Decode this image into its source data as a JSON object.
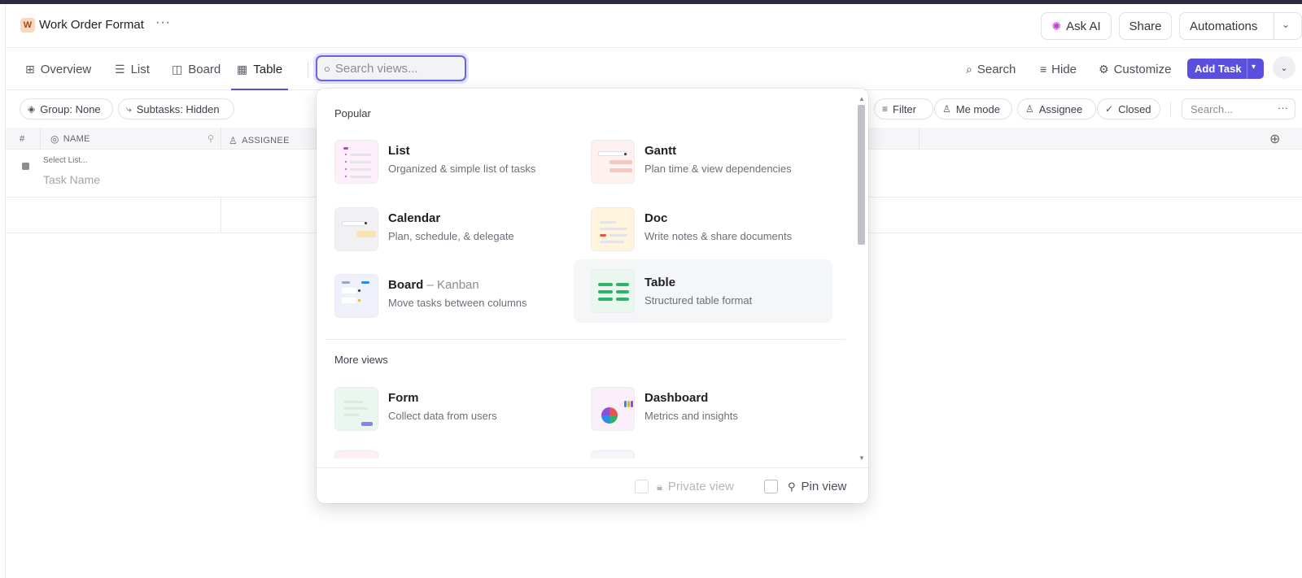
{
  "header": {
    "workspace_initial": "W",
    "page_title": "Work Order Format",
    "more": "···",
    "ask_ai": "Ask AI",
    "share": "Share",
    "automations": "Automations"
  },
  "tabs": [
    {
      "label": "Overview",
      "icon": "overview-icon"
    },
    {
      "label": "List",
      "icon": "list-icon"
    },
    {
      "label": "Board",
      "icon": "board-icon"
    },
    {
      "label": "Table",
      "icon": "table-icon",
      "active": true
    }
  ],
  "search_views": {
    "placeholder": "Search views...",
    "value": ""
  },
  "toolbar": {
    "search": "Search",
    "hide": "Hide",
    "customize": "Customize",
    "add_task": "Add Task"
  },
  "filters": {
    "group": "Group: None",
    "subtasks": "Subtasks: Hidden",
    "filter": "Filter",
    "me_mode": "Me mode",
    "assignee": "Assignee",
    "closed": "Closed",
    "search_placeholder": "Search..."
  },
  "table": {
    "columns": [
      "#",
      "NAME",
      "ASSIGNEE"
    ],
    "row": {
      "select_list": "Select List...",
      "task_name_placeholder": "Task Name"
    }
  },
  "dropdown": {
    "popular_label": "Popular",
    "popular": [
      {
        "title": "List",
        "subtitle": "",
        "desc": "Organized & simple list of tasks"
      },
      {
        "title": "Gantt",
        "subtitle": "",
        "desc": "Plan time & view dependencies"
      },
      {
        "title": "Calendar",
        "subtitle": "",
        "desc": "Plan, schedule, & delegate"
      },
      {
        "title": "Doc",
        "subtitle": "",
        "desc": "Write notes & share documents"
      },
      {
        "title": "Board",
        "subtitle": " – Kanban",
        "desc": "Move tasks between columns"
      },
      {
        "title": "Table",
        "subtitle": "",
        "desc": "Structured table format"
      }
    ],
    "more_label": "More views",
    "more": [
      {
        "title": "Form",
        "desc": "Collect data from users"
      },
      {
        "title": "Dashboard",
        "desc": "Metrics and insights"
      }
    ],
    "private_view": "Private view",
    "pin_view": "Pin view"
  },
  "colors": {
    "accent": "#5b4fe0",
    "ai": "#c13fd3"
  }
}
